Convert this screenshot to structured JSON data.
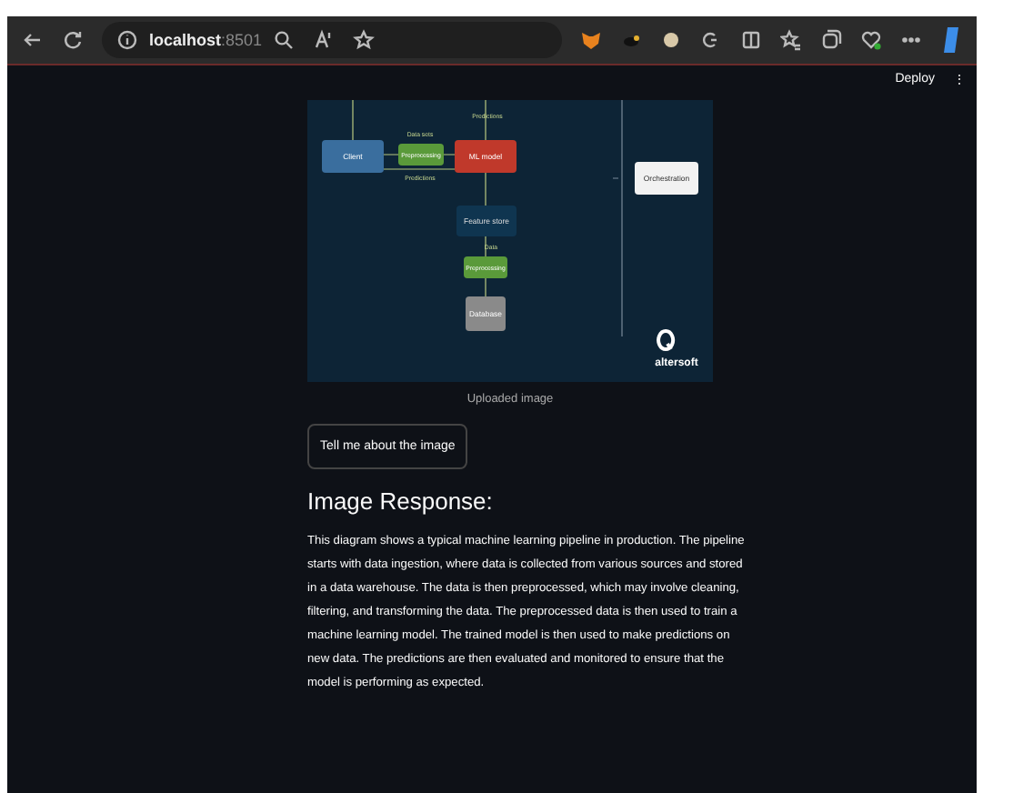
{
  "browser": {
    "url_host": "localhost",
    "url_port": ":8501"
  },
  "app_header": {
    "deploy": "Deploy",
    "menu": "⋮"
  },
  "uploaded_image": {
    "caption": "Uploaded image",
    "diagram": {
      "nodes": [
        {
          "kind": "client",
          "label": "Client"
        },
        {
          "kind": "process",
          "label": "Preprocessing"
        },
        {
          "kind": "model",
          "label": "ML model"
        },
        {
          "kind": "store",
          "label": "Feature store"
        },
        {
          "kind": "process",
          "label": "Preprocessing"
        },
        {
          "kind": "database",
          "label": "Database"
        },
        {
          "kind": "orchestration",
          "label": "Orchestration"
        }
      ],
      "edge_labels": [
        "Data sets",
        "Predictions",
        "Predictions",
        "Data"
      ],
      "logo": "altersoft"
    }
  },
  "button": "Tell me about the image",
  "response": {
    "heading": "Image Response:",
    "text": "This diagram shows a typical machine learning pipeline in production. The pipeline starts with data ingestion, where data is collected from various sources and stored in a data warehouse. The data is then preprocessed, which may involve cleaning, filtering, and transforming the data. The preprocessed data is then used to train a machine learning model. The trained model is then used to make predictions on new data. The predictions are then evaluated and monitored to ensure that the model is performing as expected."
  }
}
